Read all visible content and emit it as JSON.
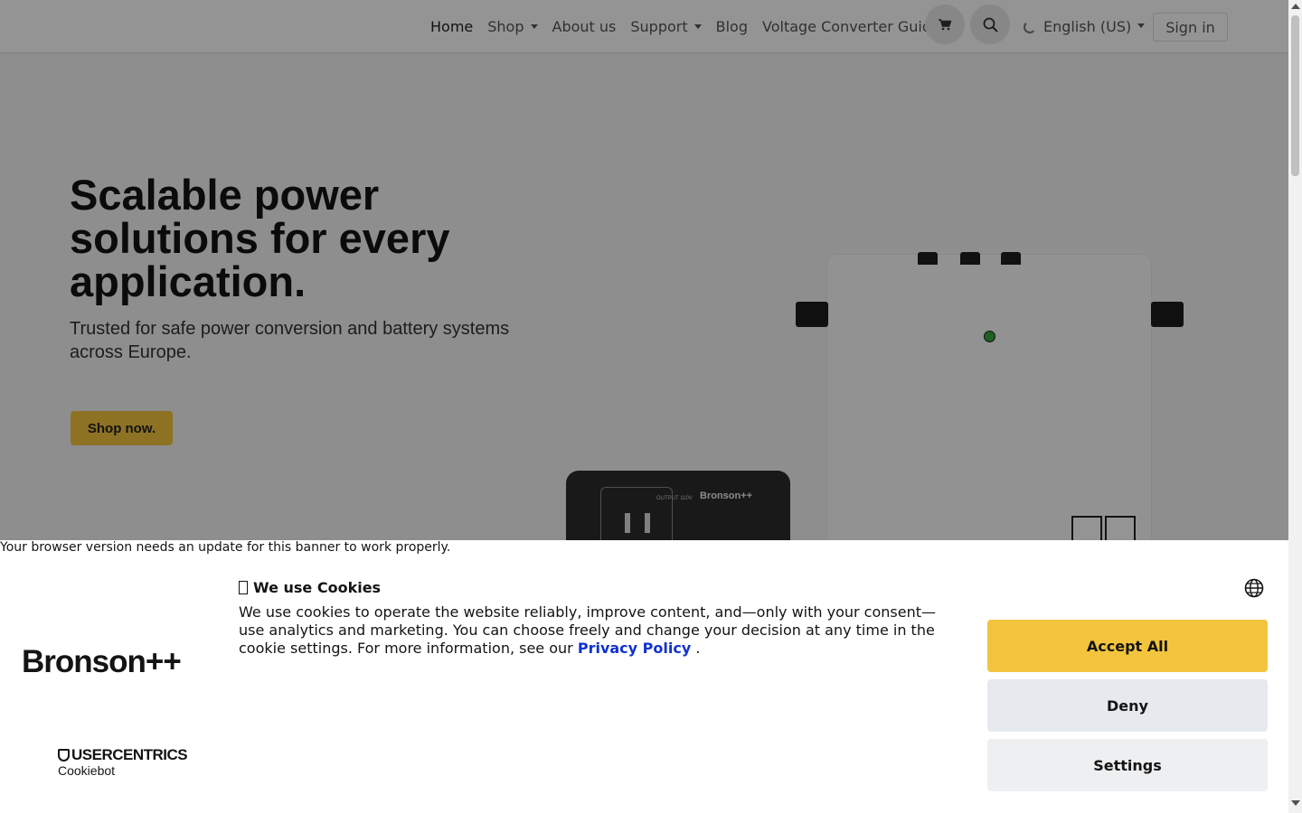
{
  "nav": {
    "items": [
      {
        "label": "Home",
        "dropdown": false,
        "active": true
      },
      {
        "label": "Shop",
        "dropdown": true
      },
      {
        "label": "About us",
        "dropdown": false
      },
      {
        "label": "Support",
        "dropdown": true
      },
      {
        "label": "Blog",
        "dropdown": false
      },
      {
        "label": "Voltage Converter Guide",
        "dropdown": false
      }
    ],
    "cart_icon": "cart-icon",
    "search_icon": "search-icon",
    "language": "English (US)",
    "sign_in": "Sign in"
  },
  "hero": {
    "title": "Scalable power solutions for every application.",
    "subtitle": "Trusted for safe power conversion and battery systems across Europe.",
    "cta": "Shop now.",
    "product_small_brand": "Bronson++",
    "product_small_output": "OUTPUT 110V"
  },
  "cookie_banner": {
    "browser_warning": "Your browser version needs an update for this banner to work properly.",
    "logo": "Bronson++",
    "provider_name": "USERCENTRICS",
    "provider_sub": "Cookiebot",
    "title": "We use Cookies",
    "body": "We use cookies to operate the website reliably, improve content, and—only with your consent—use analytics and marketing. You can choose freely and change your decision at any time in the cookie settings. For more information, see our",
    "link": "Privacy Policy",
    "body_end": ".",
    "accept": "Accept All",
    "deny": "Deny",
    "settings": "Settings"
  },
  "colors": {
    "accent": "#f3c43e",
    "link": "#1032cf",
    "deny_bg": "#e6e9ed"
  }
}
